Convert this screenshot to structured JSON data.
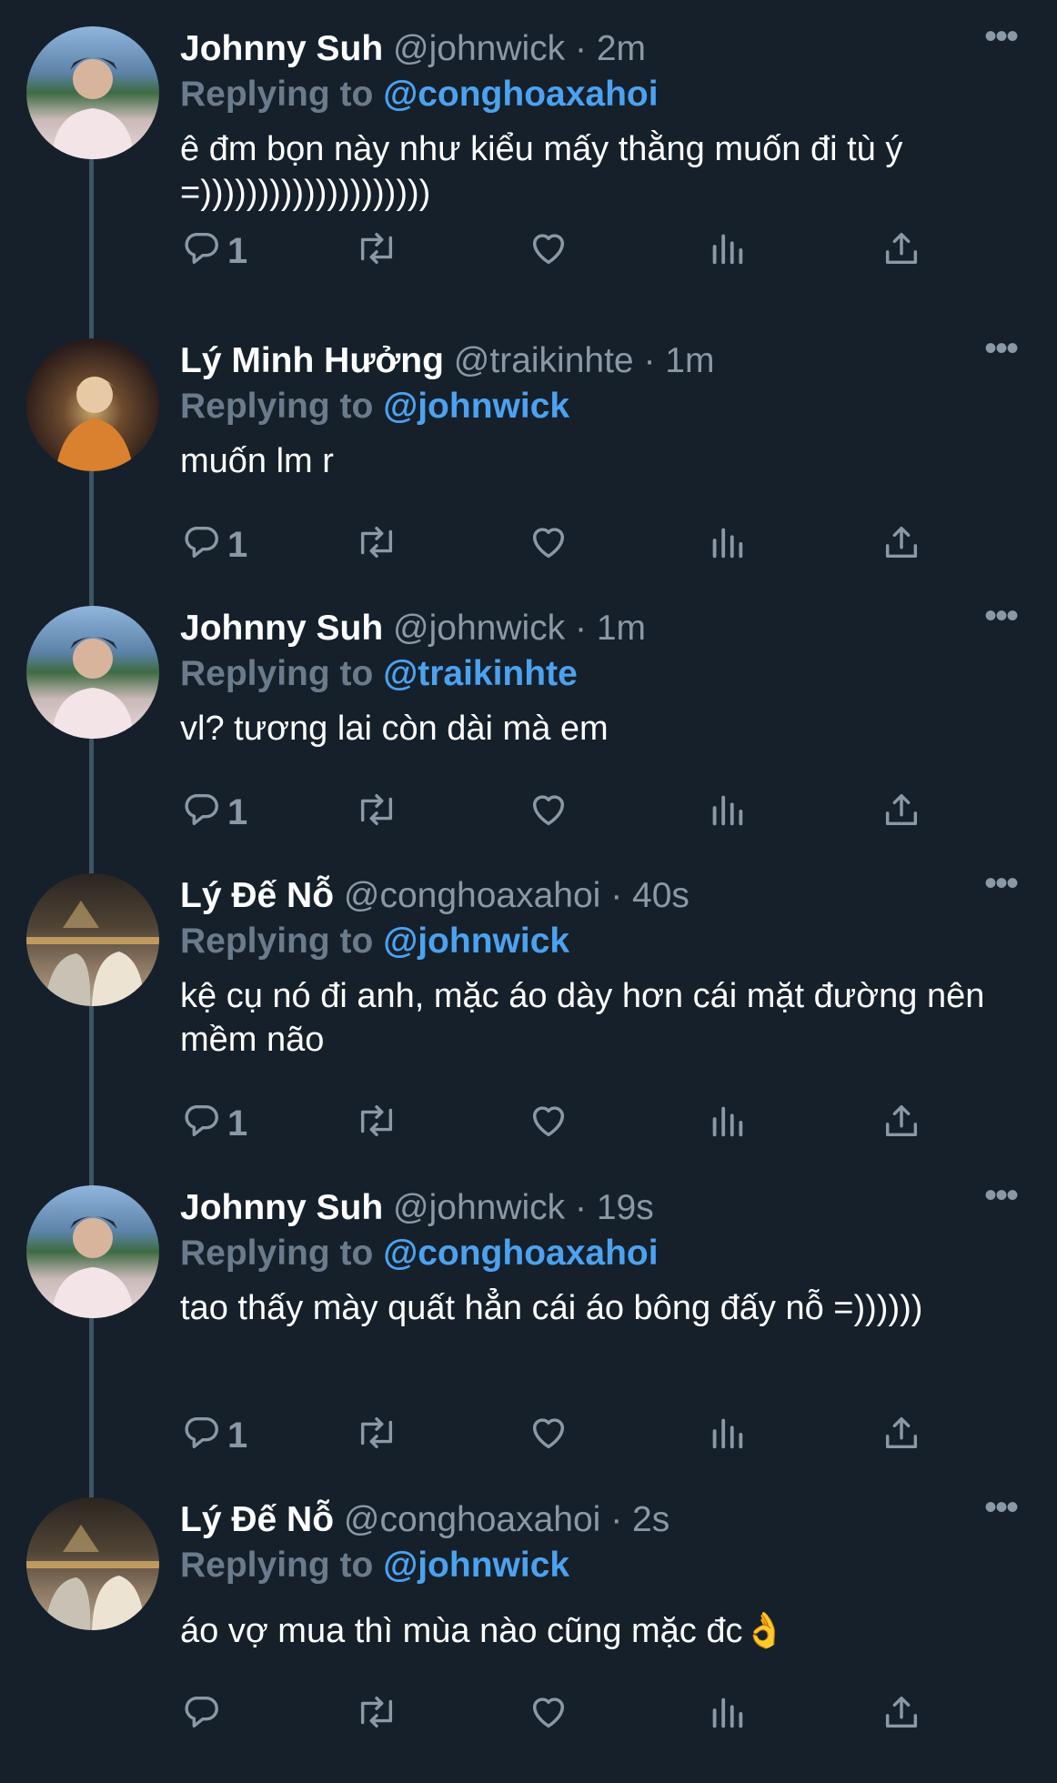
{
  "tweets": [
    {
      "avatar": "johnny-avatar",
      "name": "Johnny Suh",
      "handle": "@johnwick",
      "time": "· 2m",
      "replying_label": "Replying to",
      "replying_handle": "@conghoaxahoi",
      "text": "ê đm bọn này như kiểu mấy thằng muốn đi tù ý =))))))))))))))))))))",
      "reply_count": "1"
    },
    {
      "avatar": "ly-minh-huong-avatar",
      "name": "Lý Minh Hưởng",
      "handle": "@traikinhte",
      "time": "· 1m",
      "replying_label": "Replying to",
      "replying_handle": "@johnwick",
      "text": "muốn lm r",
      "reply_count": "1"
    },
    {
      "avatar": "johnny-avatar",
      "name": "Johnny Suh",
      "handle": "@johnwick",
      "time": "· 1m",
      "replying_label": "Replying to",
      "replying_handle": "@traikinhte",
      "text": "vl? tương lai còn dài mà em",
      "reply_count": "1"
    },
    {
      "avatar": "ly-de-no-avatar",
      "name": "Lý Đế Nỗ",
      "handle": "@conghoaxahoi",
      "time": "· 40s",
      "replying_label": "Replying to",
      "replying_handle": "@johnwick",
      "text": "kệ cụ nó đi anh, mặc áo dày hơn cái mặt đường nên mềm não",
      "reply_count": "1"
    },
    {
      "avatar": "johnny-avatar",
      "name": "Johnny Suh",
      "handle": "@johnwick",
      "time": "· 19s",
      "replying_label": "Replying to",
      "replying_handle": "@conghoaxahoi",
      "text": "tao thấy mày quất hẳn cái áo bông đấy nỗ =))))))",
      "reply_count": "1"
    },
    {
      "avatar": "ly-de-no-avatar",
      "name": "Lý Đế Nỗ",
      "handle": "@conghoaxahoi",
      "time": "· 2s",
      "replying_label": "Replying to",
      "replying_handle": "@johnwick",
      "text": "áo vợ mua thì mùa nào cũng mặc đc👌",
      "reply_count": ""
    }
  ],
  "more_label": "•••",
  "icons": {
    "reply": "reply-icon",
    "retweet": "retweet-icon",
    "like": "heart-icon",
    "views": "analytics-icon",
    "share": "share-icon"
  },
  "colors": {
    "background": "#15202b",
    "muted": "#8b98a5",
    "link": "#4ca2ef",
    "thread_line": "#3d5466"
  }
}
